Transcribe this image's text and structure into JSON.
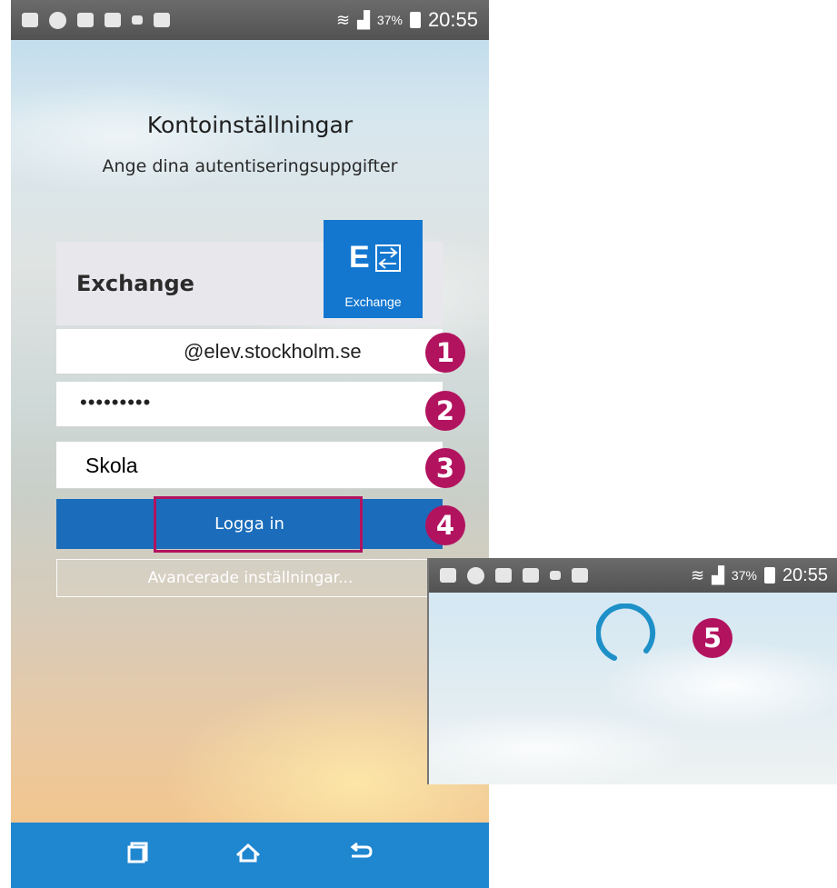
{
  "main_screen": {
    "status_bar": {
      "battery_percent": "37%",
      "time": "20:55",
      "icons": [
        "keyboard-icon",
        "sync-icon",
        "save-icon",
        "screenshot-icon",
        "usb-icon",
        "a-icon",
        "wifi-icon",
        "signal-icon",
        "battery-icon"
      ]
    },
    "title": "Kontoinställningar",
    "subtitle": "Ange dina autentiseringsuppgifter",
    "account_type": "Exchange",
    "logo": {
      "mark": "E",
      "name": "Exchange"
    },
    "email": "@elev.stockholm.se",
    "password": "•••••••••",
    "school": "Skola",
    "login_label": "Logga in",
    "advanced_label": "Avancerade inställningar...",
    "nav": {
      "recent_icon": "recent-apps-icon",
      "home_icon": "home-icon",
      "back_icon": "back-icon"
    }
  },
  "steps": [
    "1",
    "2",
    "3",
    "4",
    "5"
  ],
  "inset": {
    "battery_percent": "37%",
    "time": "20:55"
  },
  "colors": {
    "accent": "#1b6dbb",
    "badge": "#b2135f",
    "spinner": "#1e90c8",
    "nav": "#1f86d0"
  }
}
